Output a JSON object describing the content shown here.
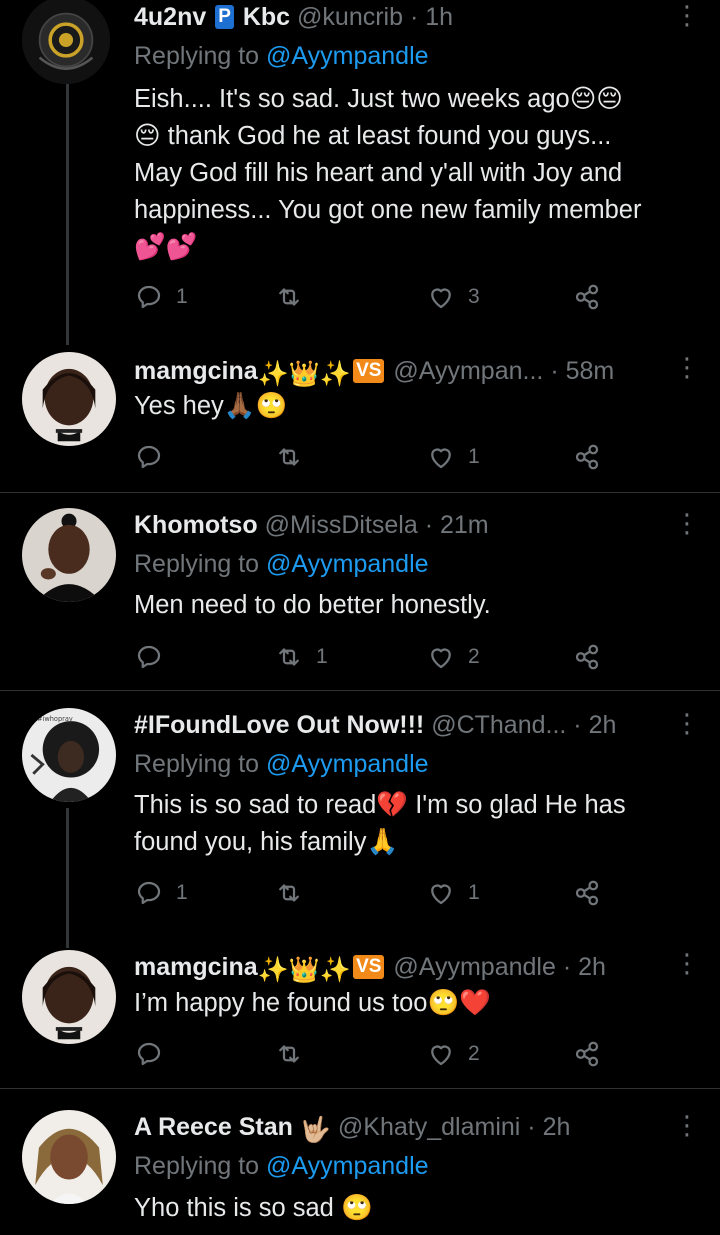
{
  "tweets": [
    {
      "name": "4u2nv",
      "badge": "P",
      "name2": "Kbc",
      "handle": "@kuncrib",
      "dot": "·",
      "time": "1h",
      "replying_label": "Replying to ",
      "replying_to": "@Ayympandle",
      "text_lines": [
        "Eish.... It's so sad. Just two weeks ago😔😔",
        "😔 thank God he at least found you guys...",
        "May God fill his heart and y'all with Joy and",
        "happiness... You got one new family member",
        "💕💕"
      ],
      "reply_count": "1",
      "retweet_count": "",
      "like_count": "3"
    },
    {
      "name": "mamgcina",
      "emojis": "✨👑✨",
      "badge": "VS",
      "handle": "@Ayympan...",
      "dot": "·",
      "time": "58m",
      "text_lines": [
        "Yes hey🙏🏾🙄"
      ],
      "reply_count": "",
      "retweet_count": "",
      "like_count": "1"
    },
    {
      "name": "Khomotso",
      "handle": "@MissDitsela",
      "dot": "·",
      "time": "21m",
      "replying_label": "Replying to ",
      "replying_to": "@Ayympandle",
      "text_lines": [
        "Men need to do better honestly."
      ],
      "reply_count": "",
      "retweet_count": "1",
      "like_count": "2"
    },
    {
      "name": "#IFoundLove Out Now!!!",
      "handle": "@CThand...",
      "dot": "·",
      "time": "2h",
      "avatar_text": "#iwhopray",
      "replying_label": "Replying to ",
      "replying_to": "@Ayympandle",
      "text_lines": [
        "This is so sad to read💔 I'm so glad He has",
        "found you, his family🙏"
      ],
      "reply_count": "1",
      "retweet_count": "",
      "like_count": "1"
    },
    {
      "name": "mamgcina",
      "emojis": "✨👑✨",
      "badge": "VS",
      "handle": "@Ayympandle",
      "dot": "·",
      "time": "2h",
      "text_lines": [
        "I’m happy he found us too🙄❤️"
      ],
      "reply_count": "",
      "retweet_count": "",
      "like_count": "2"
    },
    {
      "name": "A Reece Stan",
      "emojis": "🤟🏼",
      "handle": "@Khaty_dlamini",
      "dot": "·",
      "time": "2h",
      "replying_label": "Replying to ",
      "replying_to": "@Ayympandle",
      "text_lines": [
        "Yho this is so sad 🙄"
      ]
    }
  ],
  "icons": {
    "reply": "reply-icon",
    "retweet": "retweet-icon",
    "like": "heart-icon",
    "share": "share-icon",
    "more": "more-icon"
  },
  "colors": {
    "background": "#000000",
    "text": "#e7e9ea",
    "muted": "#71767b",
    "link": "#1d9bf0",
    "divider": "#2f3336"
  }
}
